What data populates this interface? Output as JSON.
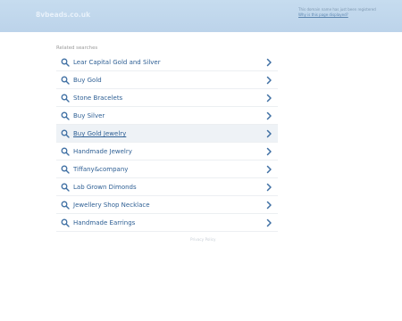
{
  "header": {
    "domain": "8vbeads.co.uk",
    "notice_text": "This domain name has just been registered",
    "notice_link": "Why is this page displayed?"
  },
  "related": {
    "label": "Related searches",
    "items": [
      {
        "label": "Lear Capital Gold and Silver"
      },
      {
        "label": "Buy Gold"
      },
      {
        "label": "Stone Bracelets"
      },
      {
        "label": "Buy Silver"
      },
      {
        "label": "Buy Gold Jewelry"
      },
      {
        "label": "Handmade Jewelry"
      },
      {
        "label": "Tiffany&company"
      },
      {
        "label": "Lab Grown Dimonds"
      },
      {
        "label": "Jewellery Shop Necklace"
      },
      {
        "label": "Handmade Earrings"
      }
    ]
  },
  "footer": {
    "privacy": "Privacy Policy"
  },
  "colors": {
    "header_bg": "#c2d9ee",
    "link": "#2e5f94",
    "icon": "#3f6fa3",
    "active_row_bg": "#eef2f6"
  },
  "icons": {
    "search": "search-icon",
    "chevron": "chevron-right-icon"
  }
}
